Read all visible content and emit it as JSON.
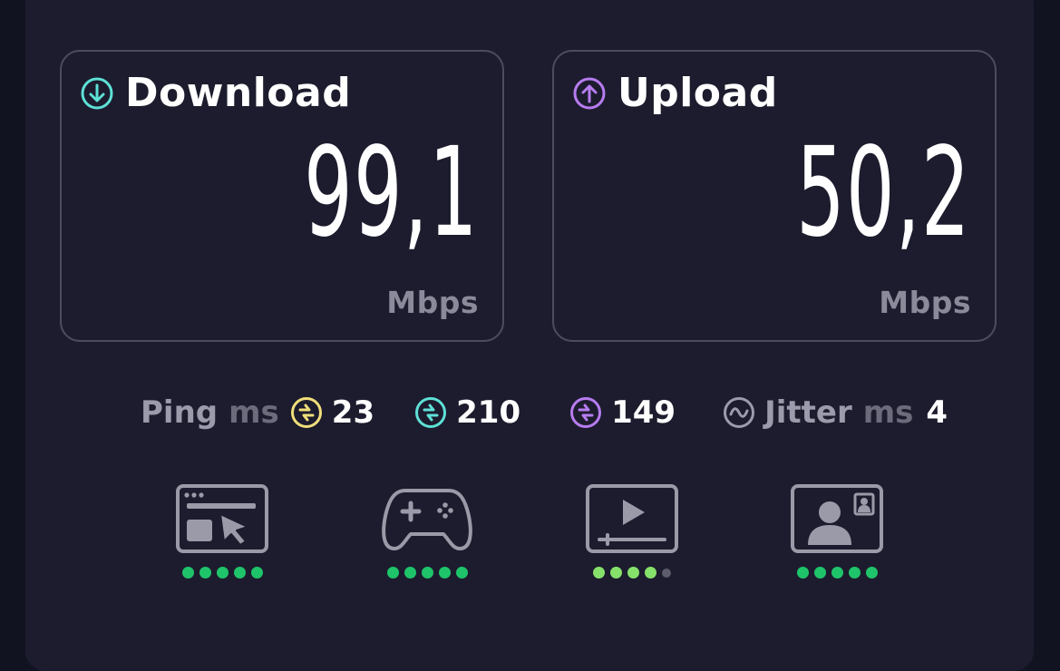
{
  "download": {
    "title": "Download",
    "value": "99,1",
    "unit": "Mbps",
    "icon": "arrow-down-circle-icon",
    "accent": "#5ee0d6"
  },
  "upload": {
    "title": "Upload",
    "value": "50,2",
    "unit": "Mbps",
    "icon": "arrow-up-circle-icon",
    "accent": "#b77cf0"
  },
  "ping": {
    "label": "Ping",
    "unit": "ms",
    "idle": {
      "value": "23",
      "color": "#f0de7a"
    },
    "download": {
      "value": "210",
      "color": "#5ee0d6"
    },
    "upload": {
      "value": "149",
      "color": "#b77cf0"
    }
  },
  "jitter": {
    "label": "Jitter",
    "unit": "ms",
    "value": "4",
    "color": "#9b9bab"
  },
  "use_cases": [
    {
      "icon": "web-browsing-icon",
      "rating": 5,
      "color": "#1fc46a"
    },
    {
      "icon": "gaming-controller-icon",
      "rating": 5,
      "color": "#1fc46a"
    },
    {
      "icon": "video-streaming-icon",
      "rating": 4,
      "color": "#86e16b"
    },
    {
      "icon": "video-call-icon",
      "rating": 5,
      "color": "#1fc46a"
    }
  ]
}
